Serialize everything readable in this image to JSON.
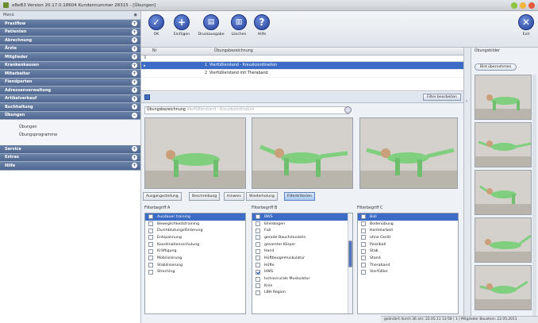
{
  "window": {
    "title": "eBeB3  Version 20.17.0.18604  Kundennummer 28315 - [Übungen]"
  },
  "sidebar": {
    "header": "Menü",
    "groups": [
      {
        "label": "Praxiflow"
      },
      {
        "label": "Patienten"
      },
      {
        "label": "Abrechnung"
      },
      {
        "label": "Ärzte"
      },
      {
        "label": "Mitglieder"
      },
      {
        "label": "Krankenkassen"
      },
      {
        "label": "Mitarbeiter"
      },
      {
        "label": "Fiendperten"
      },
      {
        "label": "Adressenverwaltung"
      },
      {
        "label": "Artikelverkauf"
      },
      {
        "label": "Buchhaltung"
      },
      {
        "label": "Übungen"
      }
    ],
    "subitems": [
      {
        "label": "Übungen"
      },
      {
        "label": "Übungsprogramme"
      }
    ],
    "lower_groups": [
      {
        "label": "Service"
      },
      {
        "label": "Extras"
      },
      {
        "label": "Hilfe"
      }
    ]
  },
  "toolbar": {
    "ok": "OK",
    "insert": "Einfügen",
    "print": "Druckausgabe",
    "delete": "Löschen",
    "help": "Hilfe",
    "exit": "Exit"
  },
  "grid": {
    "col_nr": "Nr",
    "col_name": "Übungsbezeichnung",
    "rows": [
      {
        "nr": "1",
        "name": "Vierfüßlerstand - Kreuzkoordination"
      },
      {
        "nr": "2",
        "name": "Vierfüßlerstand mit Theraband"
      }
    ]
  },
  "filterbar": {
    "button": "Filter bearbeiten"
  },
  "detail": {
    "name_label": "Übungsbezeichnung",
    "name_value": "Vierfüßlerstand - Kreuzkoordination"
  },
  "tabs": [
    {
      "label": "Ausgangsstellung"
    },
    {
      "label": "Beschreibung"
    },
    {
      "label": "Hinweis"
    },
    {
      "label": "Wiederholung"
    },
    {
      "label": "Filterkriterien"
    }
  ],
  "filters": {
    "a": {
      "title": "Filterbegriff A",
      "items": [
        {
          "label": "Ausdauer training",
          "checked": false,
          "selected": true
        },
        {
          "label": "Beweglichkeitstraining",
          "checked": false
        },
        {
          "label": "Durchblutungsförderung",
          "checked": false
        },
        {
          "label": "Entspannung",
          "checked": false
        },
        {
          "label": "Koordinationsschulung",
          "checked": false
        },
        {
          "label": "Kräftigung",
          "checked": false
        },
        {
          "label": "Mobilisierung",
          "checked": false
        },
        {
          "label": "Stabilisierung",
          "checked": false
        },
        {
          "label": "Streching",
          "checked": false
        }
      ]
    },
    "b": {
      "title": "Filterbegriff B",
      "items": [
        {
          "label": "BWS",
          "checked": false,
          "selected": true
        },
        {
          "label": "Ellenbogen",
          "checked": false
        },
        {
          "label": "Fuß",
          "checked": false
        },
        {
          "label": "gerade Bauchmuskeln",
          "checked": false
        },
        {
          "label": "gesamter Körper",
          "checked": false
        },
        {
          "label": "Hand",
          "checked": false
        },
        {
          "label": "Hüftbeugemuskulatur",
          "checked": false
        },
        {
          "label": "Hüfte",
          "checked": false
        },
        {
          "label": "HWS",
          "checked": true
        },
        {
          "label": "Ischiocrurale Muskulatur",
          "checked": false
        },
        {
          "label": "Knie",
          "checked": false
        },
        {
          "label": "LBH Region",
          "checked": false
        }
      ]
    },
    "c": {
      "title": "Filterbegriff C",
      "items": [
        {
          "label": "Ball",
          "checked": false,
          "selected": true
        },
        {
          "label": "Bodenübung",
          "checked": false
        },
        {
          "label": "Hantelarbeit",
          "checked": false
        },
        {
          "label": "ohne Gerät",
          "checked": false
        },
        {
          "label": "Pezziball",
          "checked": false
        },
        {
          "label": "Stab",
          "checked": false
        },
        {
          "label": "Stand",
          "checked": false
        },
        {
          "label": "Theraband",
          "checked": false
        },
        {
          "label": "Vierfüßler",
          "checked": false
        }
      ]
    }
  },
  "right_panel": {
    "title": "Übungsbilder",
    "button": "Bild übernehmen"
  },
  "status": {
    "text": "geändert durch 36 am: 22.05.11 13:58 | 1 | Mitglieder Baustein: 22.05.2011"
  },
  "colors": {
    "accent": "#3d6cc6",
    "sidebar_header": "#4f6790",
    "skin": "#7fcf7f"
  }
}
